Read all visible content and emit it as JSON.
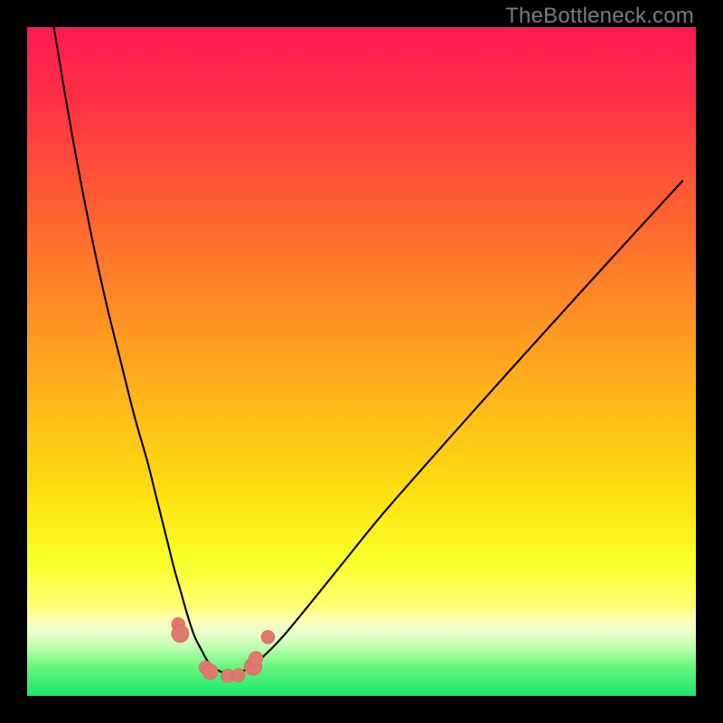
{
  "watermark": "TheBottleneck.com",
  "colors": {
    "frame": "#000000",
    "watermark": "#7b7b7b",
    "curve": "#000000",
    "marker_fill": "#e0796f",
    "marker_stroke": "#d66257",
    "gradient_stops": [
      {
        "offset": 0.0,
        "color": "#ff1a51"
      },
      {
        "offset": 0.1,
        "color": "#ff2e47"
      },
      {
        "offset": 0.25,
        "color": "#ff5a33"
      },
      {
        "offset": 0.4,
        "color": "#ff8726"
      },
      {
        "offset": 0.55,
        "color": "#ffb41a"
      },
      {
        "offset": 0.7,
        "color": "#ffe011"
      },
      {
        "offset": 0.8,
        "color": "#f9ff2b"
      },
      {
        "offset": 0.865,
        "color": "#ffff73"
      },
      {
        "offset": 0.885,
        "color": "#ffffb3"
      },
      {
        "offset": 0.905,
        "color": "#e8ffcc"
      },
      {
        "offset": 0.925,
        "color": "#c4ffb3"
      },
      {
        "offset": 0.955,
        "color": "#6cf57e"
      },
      {
        "offset": 1.0,
        "color": "#17e86a"
      }
    ]
  },
  "chart_data": {
    "type": "line",
    "title": "",
    "xlabel": "",
    "ylabel": "",
    "xlim": [
      0,
      100
    ],
    "ylim": [
      0,
      100
    ],
    "grid": false,
    "legend": false,
    "series": [
      {
        "name": "v-curve",
        "x": [
          4,
          6,
          8,
          10,
          12,
          14,
          16,
          18,
          19,
          20,
          21,
          22,
          23,
          24,
          25,
          26,
          27,
          28,
          29,
          30,
          31,
          32,
          33,
          35,
          38,
          42,
          47,
          53,
          60,
          68,
          77,
          87,
          98
        ],
        "y": [
          100,
          88,
          77,
          67,
          58,
          50,
          42,
          35,
          31,
          27,
          23,
          19,
          15.5,
          12,
          9,
          7,
          5.2,
          4.2,
          3.6,
          3.4,
          3.4,
          3.6,
          4.1,
          5.6,
          8.6,
          13.4,
          19.6,
          27,
          35,
          44,
          54,
          65,
          77
        ]
      }
    ],
    "markers": [
      {
        "x": 22.6,
        "y": 10.7,
        "r": 1.0
      },
      {
        "x": 22.9,
        "y": 9.3,
        "r": 1.3
      },
      {
        "x": 26.7,
        "y": 4.25,
        "r": 1.0
      },
      {
        "x": 27.4,
        "y": 3.6,
        "r": 1.15
      },
      {
        "x": 30.0,
        "y": 3.0,
        "r": 1.0
      },
      {
        "x": 31.6,
        "y": 3.1,
        "r": 1.0
      },
      {
        "x": 33.8,
        "y": 4.4,
        "r": 1.3
      },
      {
        "x": 34.2,
        "y": 5.6,
        "r": 1.05
      },
      {
        "x": 36.0,
        "y": 8.8,
        "r": 1.0
      }
    ]
  }
}
